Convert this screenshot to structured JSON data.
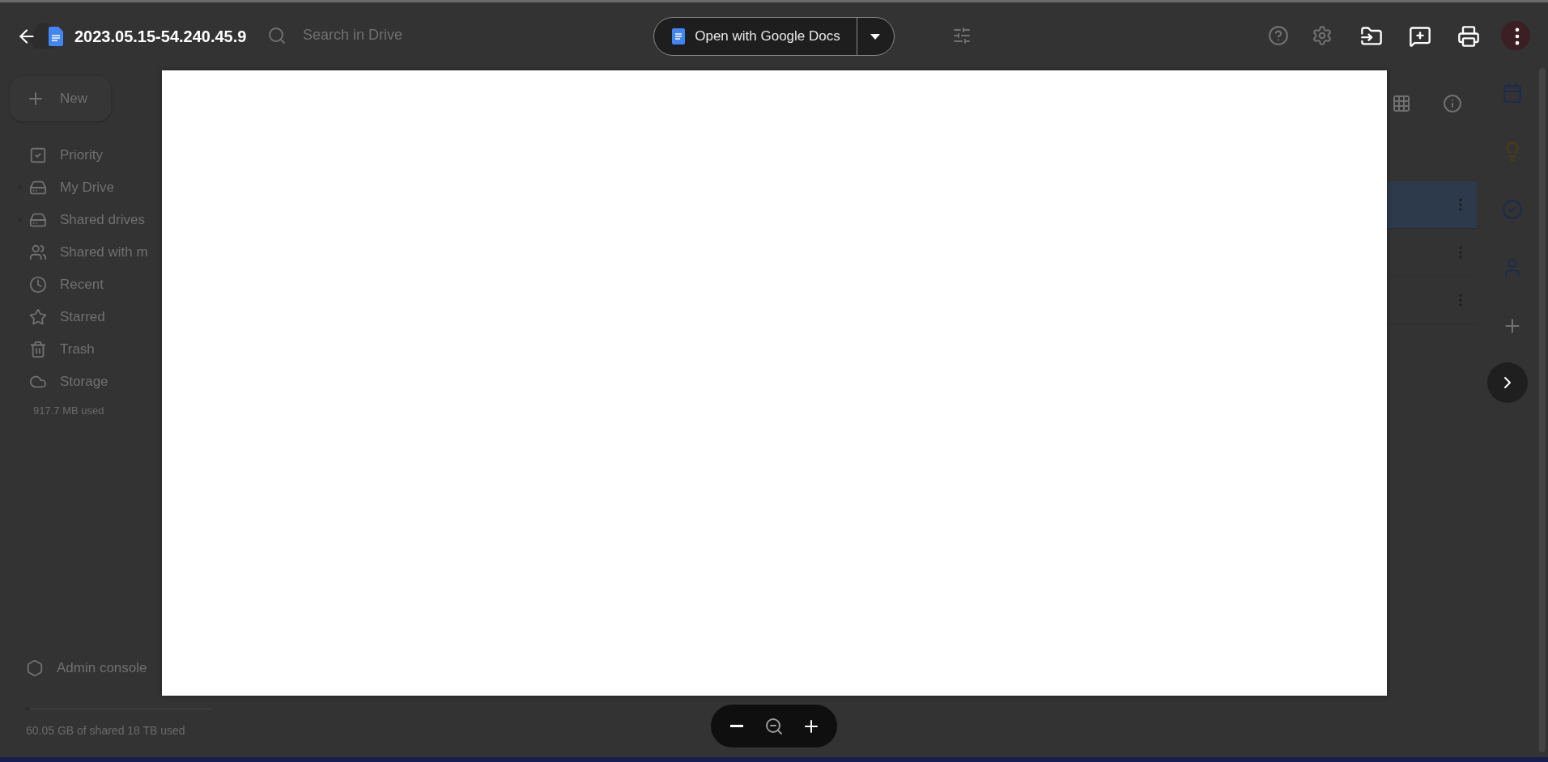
{
  "viewer": {
    "file_title": "2023.05.15-54.240.45.9",
    "open_with": {
      "label": "Open with Google Docs"
    }
  },
  "drive": {
    "search": {
      "placeholder": "Search in Drive"
    },
    "new_button": {
      "label": "New"
    },
    "sidebar": {
      "items": [
        {
          "kind": "priority",
          "label": "Priority",
          "expandable": false
        },
        {
          "kind": "my-drive",
          "label": "My Drive",
          "expandable": true
        },
        {
          "kind": "shared-drives",
          "label": "Shared drives",
          "expandable": true
        },
        {
          "kind": "shared",
          "label": "Shared with m",
          "expandable": false
        },
        {
          "kind": "recent",
          "label": "Recent",
          "expandable": false
        },
        {
          "kind": "starred",
          "label": "Starred",
          "expandable": false
        },
        {
          "kind": "trash",
          "label": "Trash",
          "expandable": false
        },
        {
          "kind": "storage",
          "label": "Storage",
          "expandable": false
        }
      ],
      "storage_used": "917.7 MB used",
      "admin": {
        "label": "Admin console"
      },
      "shared_storage": {
        "level": 0.02,
        "text": "60.05 GB of shared 18 TB used"
      }
    },
    "file_rows": [
      {
        "selected": true
      },
      {
        "selected": false
      },
      {
        "selected": false
      }
    ],
    "side_apps": [
      {
        "kind": "calendar"
      },
      {
        "kind": "keep"
      },
      {
        "kind": "tasks"
      },
      {
        "kind": "contacts"
      }
    ]
  }
}
